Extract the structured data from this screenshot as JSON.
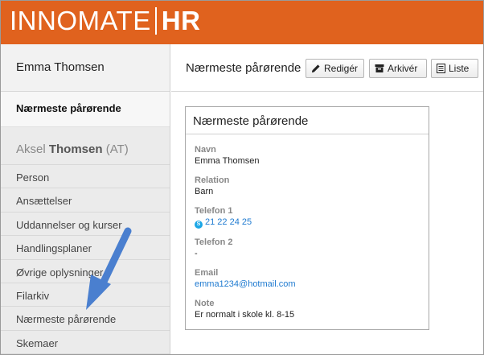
{
  "header": {
    "logo_left": "INNOMATE",
    "logo_right": "HR",
    "brand_color": "#e0621e"
  },
  "sidebar": {
    "user_name": "Emma Thomsen",
    "active_section": "Nærmeste pårørende",
    "person": {
      "first": "Aksel",
      "last": "Thomsen",
      "suffix": "(AT)"
    },
    "items": [
      {
        "label": "Person"
      },
      {
        "label": "Ansættelser"
      },
      {
        "label": "Uddannelser og kurser"
      },
      {
        "label": "Handlingsplaner"
      },
      {
        "label": "Øvrige oplysninger"
      },
      {
        "label": "Filarkiv"
      },
      {
        "label": "Nærmeste pårørende"
      },
      {
        "label": "Skemaer"
      }
    ]
  },
  "main": {
    "title": "Nærmeste pårørende",
    "buttons": {
      "edit": "Redigér",
      "archive": "Arkivér",
      "list": "Liste"
    }
  },
  "card": {
    "title": "Nærmeste pårørende",
    "fields": [
      {
        "label": "Navn",
        "value": "Emma Thomsen"
      },
      {
        "label": "Relation",
        "value": "Barn"
      },
      {
        "label": "Telefon 1",
        "value": "21 22 24 25"
      },
      {
        "label": "Telefon 2",
        "value": "-"
      },
      {
        "label": "Email",
        "value": "emma1234@hotmail.com"
      },
      {
        "label": "Note",
        "value": "Er normalt i skole kl. 8-15"
      }
    ]
  },
  "annotation": {
    "arrow_color": "#4a7fcf",
    "icons": [
      "pencil-icon",
      "archive-icon",
      "list-icon",
      "skype-icon"
    ]
  }
}
